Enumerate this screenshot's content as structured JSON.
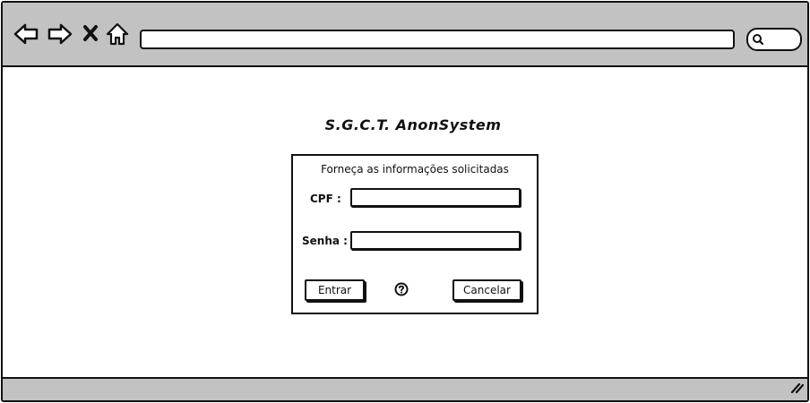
{
  "browser": {
    "address_bar_value": "",
    "search_value": "",
    "icons": [
      "back-arrow-icon",
      "forward-arrow-icon",
      "close-icon",
      "home-icon",
      "search-icon",
      "resize-handle-icon"
    ]
  },
  "app": {
    "title": "S.G.C.T.  AnonSystem"
  },
  "login_form": {
    "caption": "Forneça as informações solicitadas",
    "cpf_label": "CPF :",
    "cpf_value": "",
    "password_label": "Senha :",
    "password_value": "",
    "submit_label": "Entrar",
    "help_icon": "question-mark-icon",
    "cancel_label": "Cancelar"
  }
}
